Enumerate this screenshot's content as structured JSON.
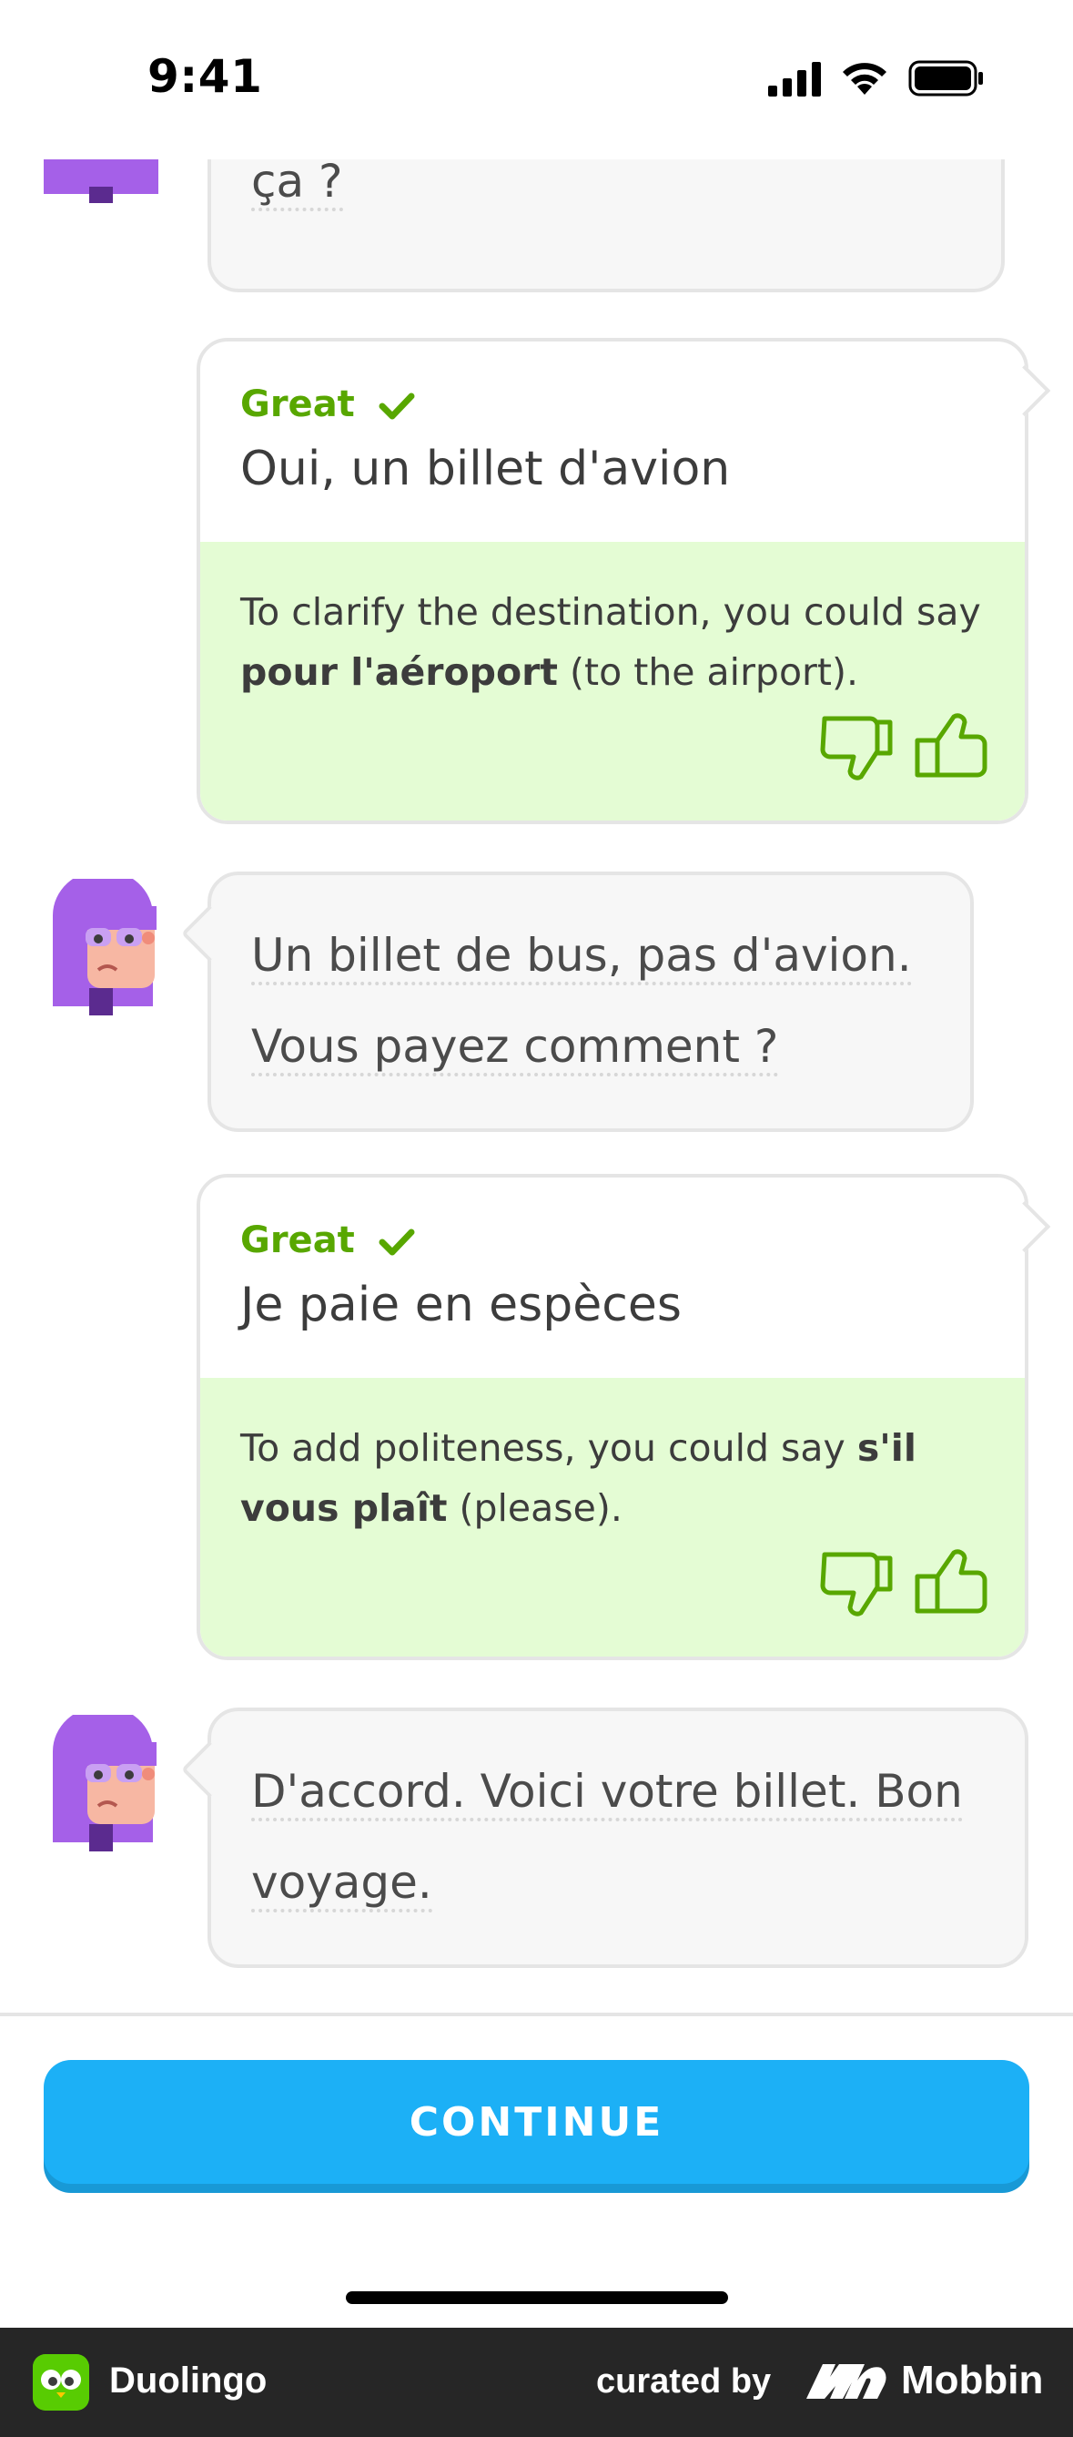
{
  "status_bar": {
    "time": "9:41"
  },
  "chat": {
    "partner_messages": [
      {
        "lines": [
          "ça ?"
        ]
      },
      {
        "lines": [
          "Un billet de bus, pas d'avion.",
          "Vous payez comment ?"
        ]
      },
      {
        "lines": [
          "D'accord. Voici votre billet. Bon",
          "voyage."
        ]
      }
    ],
    "user_messages": [
      {
        "rating": "Great",
        "text": "Oui, un billet d'avion",
        "tip_prefix": "To clarify the destination, you could say ",
        "tip_bold": "pour l'aéroport",
        "tip_suffix": " (to the airport)."
      },
      {
        "rating": "Great",
        "text": "Je paie en espèces",
        "tip_prefix": "To add politeness, you could say ",
        "tip_bold": "s'il vous plaît",
        "tip_suffix": " (please)."
      }
    ]
  },
  "continue_label": "CONTINUE",
  "footer": {
    "app_name": "Duolingo",
    "curated_by": "curated by",
    "brand": "Mobbin"
  },
  "colors": {
    "great_green": "#58a700",
    "tip_bg": "#e4fcd4",
    "continue_blue": "#1cb0f6",
    "avatar_purple": "#a560e8"
  }
}
